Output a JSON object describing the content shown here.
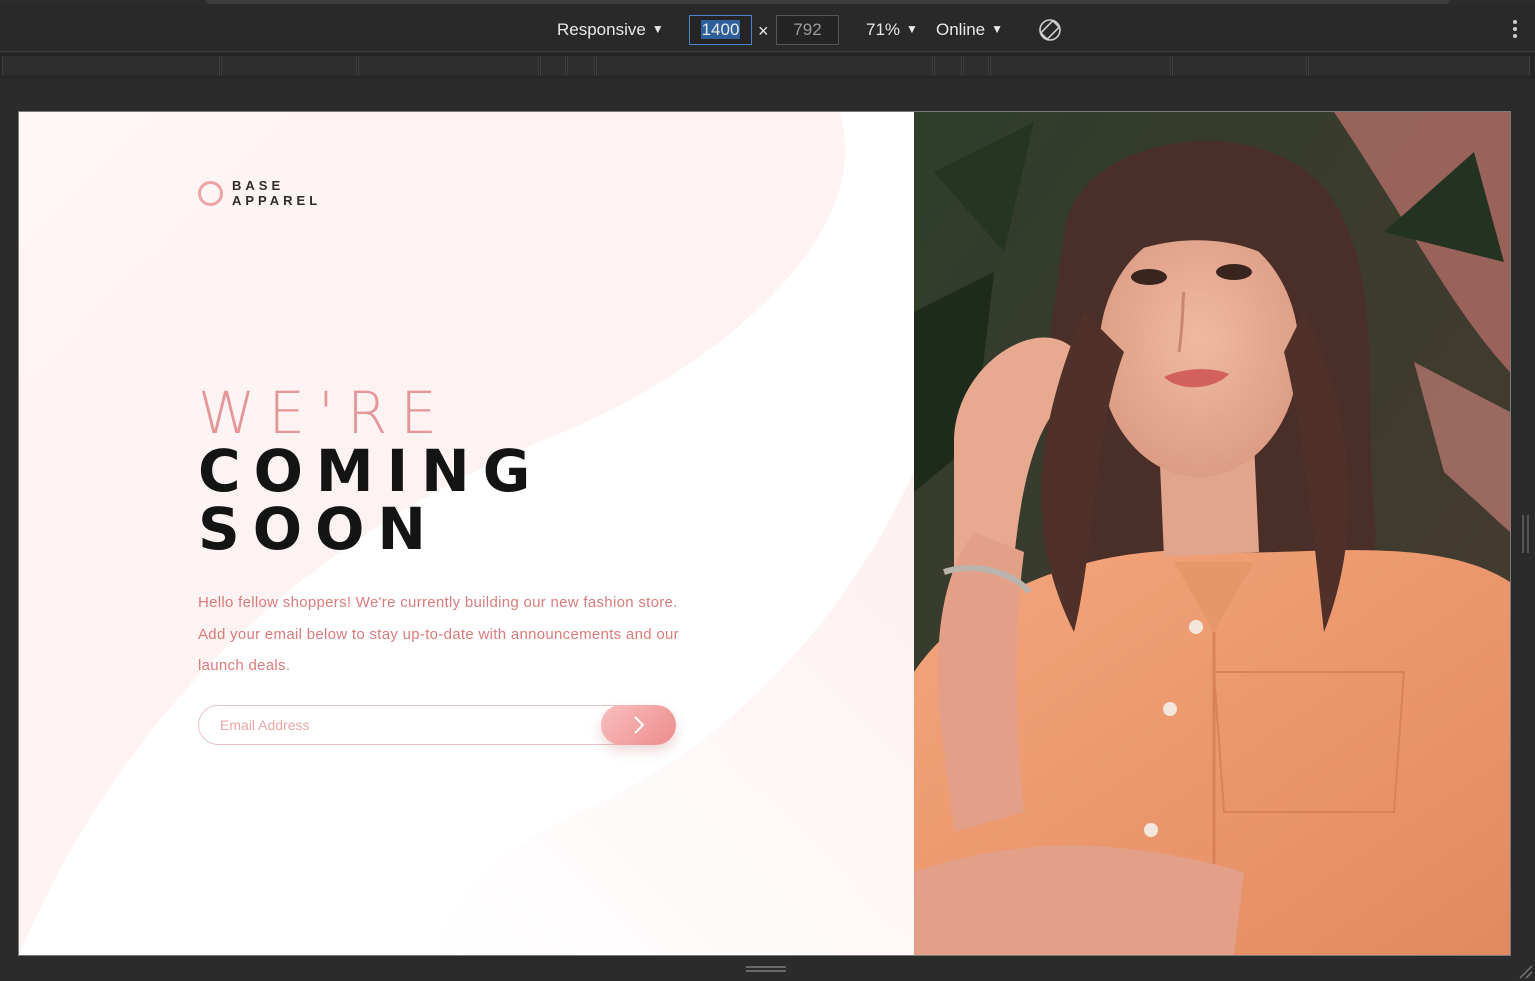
{
  "devtools": {
    "device_mode": "Responsive",
    "width": "1400",
    "height": "792",
    "times_symbol": "×",
    "zoom": "71%",
    "network": "Online",
    "icons": [
      "dropdown-caret-icon",
      "rotate-icon",
      "more-options-icon"
    ]
  },
  "page": {
    "logo": {
      "line1": "BASE",
      "line2": "APPAREL",
      "accent_color": "#efa4a4"
    },
    "headline": {
      "line1": "WE'RE",
      "line2": "COMING",
      "line3": "SOON"
    },
    "intro": "Hello fellow shoppers! We're currently building our new fashion store. Add your email below to stay up-to-date with announcements and our launch deals.",
    "email_form": {
      "placeholder": "Email Address",
      "value": "",
      "submit_icon": "chevron-right-icon"
    },
    "colors": {
      "accent_pink": "#e49797",
      "heading_dark": "#141414",
      "body_text": "#d97b7b"
    },
    "hero_image": "woman-in-peach-shirt-photo"
  }
}
